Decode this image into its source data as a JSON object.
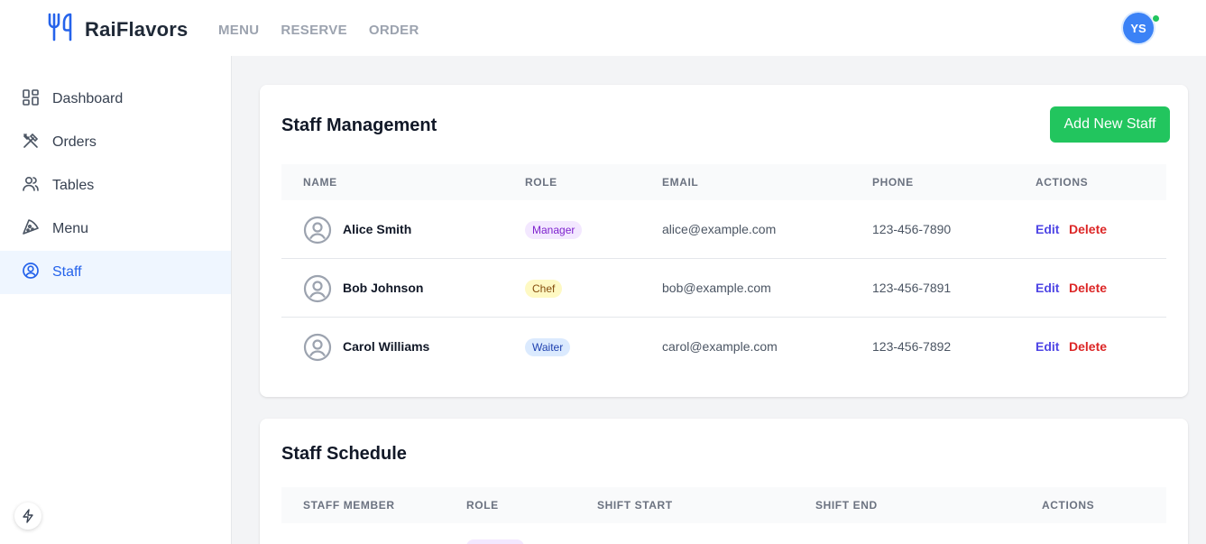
{
  "app": {
    "brand": "RaiFlavors",
    "nav": [
      "MENU",
      "RESERVE",
      "ORDER"
    ],
    "user_initials": "YS"
  },
  "sidebar": {
    "items": [
      {
        "label": "Dashboard",
        "icon": "dashboard-icon",
        "active": false
      },
      {
        "label": "Orders",
        "icon": "utensils-crossed-icon",
        "active": false
      },
      {
        "label": "Tables",
        "icon": "users-icon",
        "active": false
      },
      {
        "label": "Menu",
        "icon": "pizza-slice-icon",
        "active": false
      },
      {
        "label": "Staff",
        "icon": "user-circle-icon",
        "active": true
      }
    ]
  },
  "staff_management": {
    "title": "Staff Management",
    "add_label": "Add New Staff",
    "columns": [
      "NAME",
      "ROLE",
      "EMAIL",
      "PHONE",
      "ACTIONS"
    ],
    "rows": [
      {
        "name": "Alice Smith",
        "role": "Manager",
        "email": "alice@example.com",
        "phone": "123-456-7890",
        "edit": "Edit",
        "delete": "Delete"
      },
      {
        "name": "Bob Johnson",
        "role": "Chef",
        "email": "bob@example.com",
        "phone": "123-456-7891",
        "edit": "Edit",
        "delete": "Delete"
      },
      {
        "name": "Carol Williams",
        "role": "Waiter",
        "email": "carol@example.com",
        "phone": "123-456-7892",
        "edit": "Edit",
        "delete": "Delete"
      }
    ]
  },
  "staff_schedule": {
    "title": "Staff Schedule",
    "columns": [
      "STAFF MEMBER",
      "ROLE",
      "SHIFT START",
      "SHIFT END",
      "ACTIONS"
    ]
  },
  "colors": {
    "primary": "#2563eb",
    "success": "#22c55e",
    "manager_badge_bg": "#f3e8ff",
    "manager_badge_fg": "#7e22ce",
    "chef_badge_bg": "#fef9c3",
    "chef_badge_fg": "#854d0e",
    "waiter_badge_bg": "#dbeafe",
    "waiter_badge_fg": "#1e40af",
    "edit": "#4f46e5",
    "delete": "#dc2626"
  }
}
